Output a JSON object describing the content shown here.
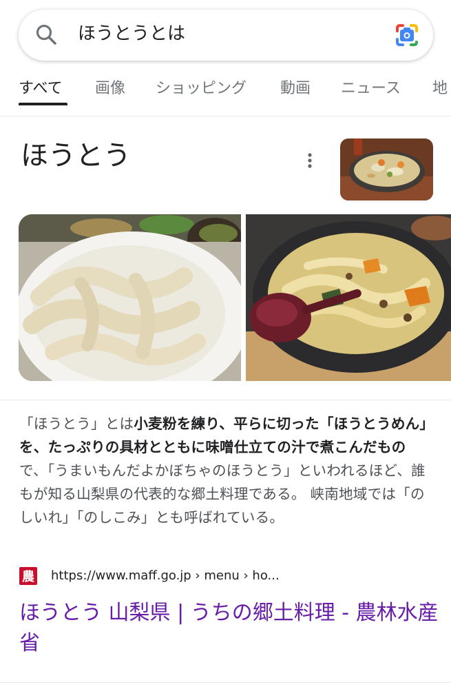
{
  "search": {
    "query": "ほうとうとは"
  },
  "tabs": [
    {
      "label": "すべて",
      "active": true
    },
    {
      "label": "画像"
    },
    {
      "label": "ショッピング"
    },
    {
      "label": "動画"
    },
    {
      "label": "ニュース"
    },
    {
      "label": "地"
    }
  ],
  "knowledge_panel": {
    "title": "ほうとう"
  },
  "snippet": {
    "part1": "「ほうとう」とは",
    "bold1": "小麦粉を練り、平らに切った「ほうとうめん」を、たっぷりの具材とともに味噌仕立ての汁で煮こんだもの",
    "part2": "で、「うまいもんだよかぼちゃのほうとう」といわれるほど、誰もが知る山梨県の代表的な郷土料理である。 峡南地域では「のしいれ」「のしこみ」とも呼ばれている。"
  },
  "source": {
    "favicon_text": "農",
    "url": "https://www.maff.go.jp › menu › ho..."
  },
  "result": {
    "title": "ほうとう 山梨県 | うちの郷土料理 - 農林水産省"
  },
  "colors": {
    "visited_link": "#681da8",
    "favicon_red": "#c8102e"
  }
}
